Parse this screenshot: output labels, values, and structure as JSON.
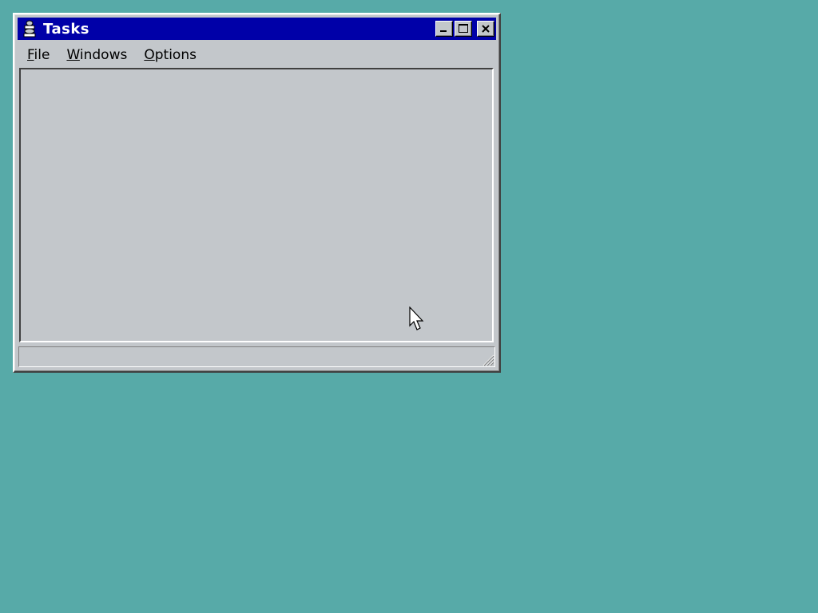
{
  "window": {
    "title": "Tasks",
    "icon": "tasks-app-icon",
    "caption_buttons": [
      "minimize",
      "maximize",
      "close"
    ]
  },
  "menubar": {
    "items": [
      {
        "label": "File",
        "mnemonic": "F",
        "rest": "ile"
      },
      {
        "label": "Windows",
        "mnemonic": "W",
        "rest": "indows"
      },
      {
        "label": "Options",
        "mnemonic": "O",
        "rest": "ptions"
      }
    ]
  },
  "statusbar": {
    "text": ""
  },
  "colors": {
    "desktop": "#57aaa8",
    "titlebar": "#0000a8",
    "face": "#c3c7cb"
  }
}
